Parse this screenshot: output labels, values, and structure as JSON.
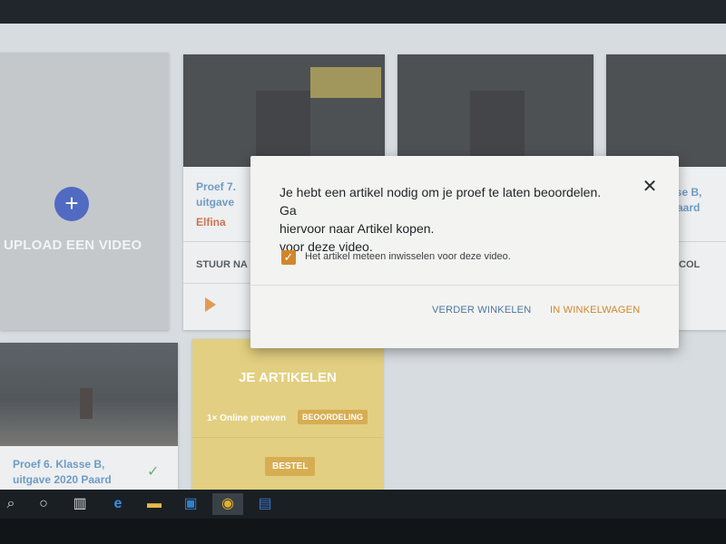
{
  "upload": {
    "label": "UPLOAD EEN VIDEO",
    "plus": "+"
  },
  "cards": [
    {
      "title_lines": [
        "Proef 7.",
        "uitgave"
      ],
      "owner": "Elfina",
      "action": "STUUR NA"
    },
    {
      "title_lines": [
        "sse B,",
        "Paard"
      ],
      "action": "COL"
    },
    {
      "title_lines": [
        "Proef 6. Klasse B,",
        "uitgave 2020 Paard"
      ]
    }
  ],
  "articles": {
    "title": "JE ARTIKELEN",
    "count": "1× Online proeven",
    "badge": "BEOORDELING",
    "order_button": "BESTEL"
  },
  "dialog": {
    "message_lines": [
      "Je hebt een artikel nodig om je proef te laten beoordelen. Ga",
      "hiervoor naar Artikel kopen.",
      "voor deze video."
    ],
    "checkbox_label": "Het artikel meteen inwisselen voor deze video.",
    "checkbox_checked": true,
    "close": "✕",
    "secondary_button": "VERDER WINKELEN",
    "primary_button": "IN WINKELWAGEN"
  },
  "taskbar": {
    "icons": [
      "search-icon",
      "cortana-icon",
      "task-view-icon",
      "edge-icon",
      "file-explorer-icon",
      "outlook-icon",
      "chrome-icon",
      "word-icon"
    ]
  },
  "colors": {
    "accent": "#d2862c",
    "link": "#4b77a1",
    "articles_bg": "#dcc566"
  }
}
